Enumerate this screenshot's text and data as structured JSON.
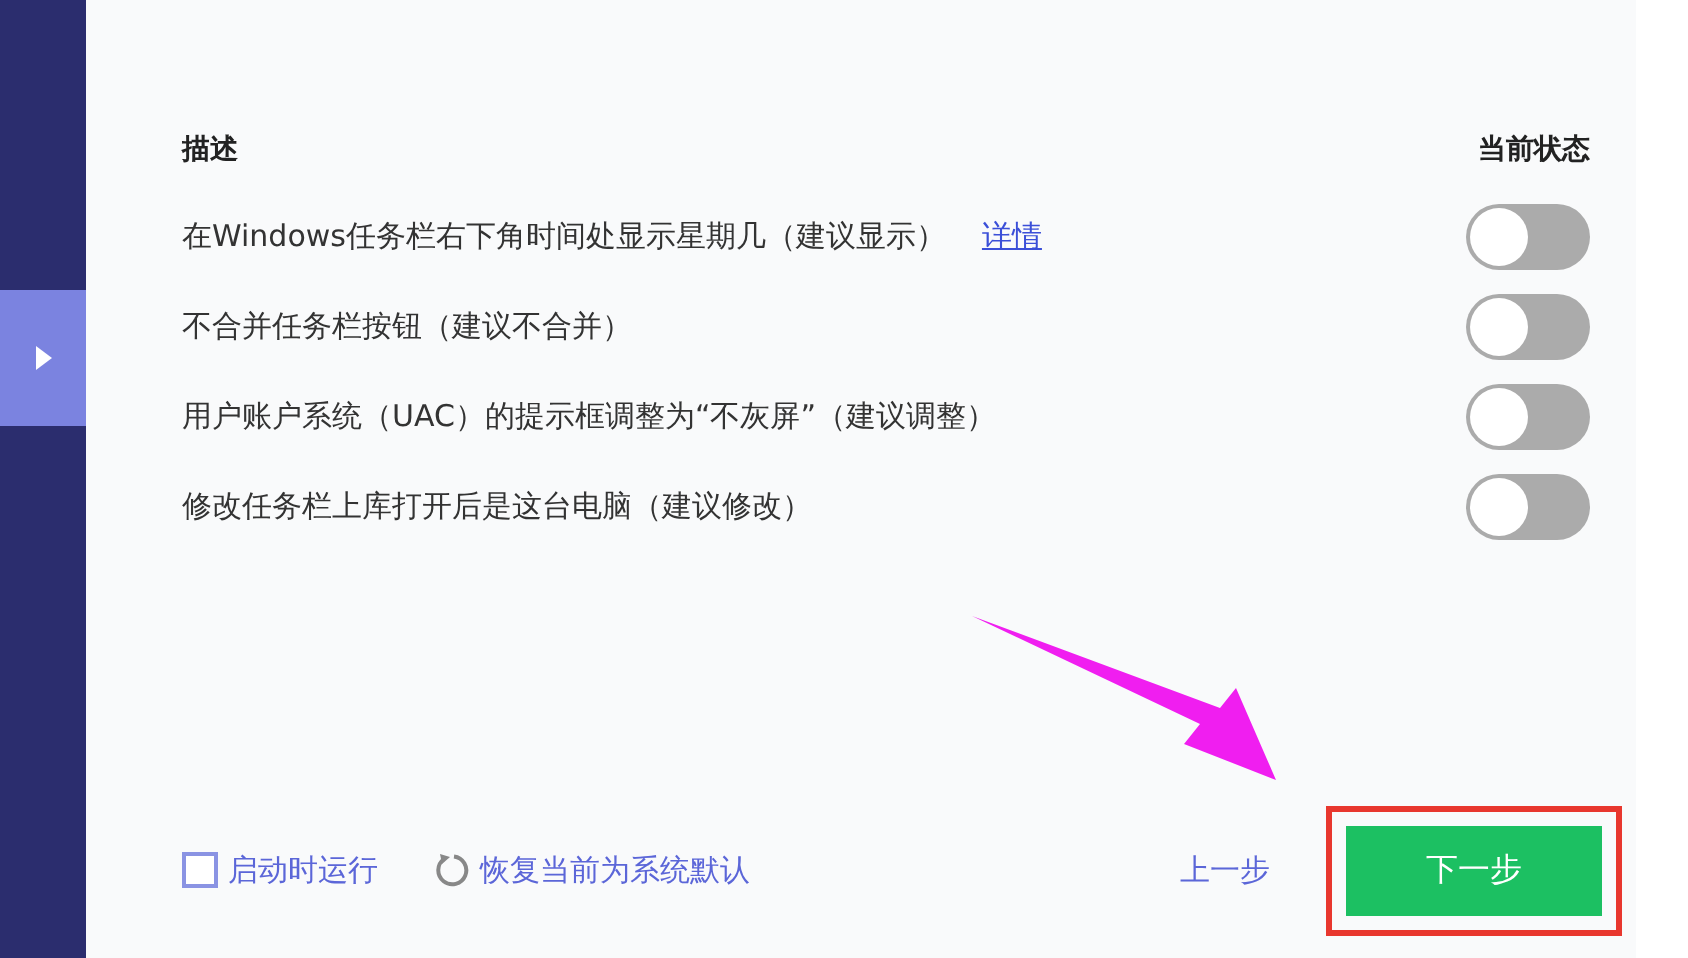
{
  "header": {
    "description": "描述",
    "status": "当前状态"
  },
  "options": [
    {
      "label": "在Windows任务栏右下角时间处显示星期几（建议显示）",
      "link": "详情",
      "on": false
    },
    {
      "label": "不合并任务栏按钮（建议不合并）",
      "on": false
    },
    {
      "label": "用户账户系统（UAC）的提示框调整为“不灰屏”（建议调整）",
      "on": false
    },
    {
      "label": "修改任务栏上库打开后是这台电脑（建议修改）",
      "on": false
    }
  ],
  "footer": {
    "run_at_startup": {
      "label": "启动时运行",
      "checked": false
    },
    "restore": "恢复当前为系统默认",
    "prev": "上一步",
    "next": "下一步"
  }
}
